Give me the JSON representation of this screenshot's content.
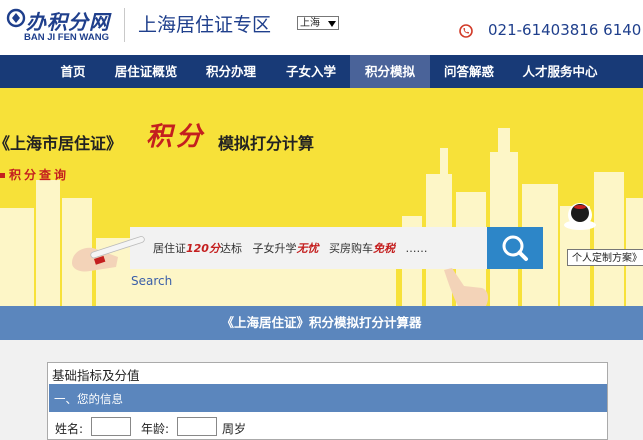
{
  "header": {
    "logo_cn": "办积分网",
    "logo_en": "BAN JI FEN WANG",
    "site_title": "上海居住证专区",
    "city_select": "上海",
    "phone": "021-61403816  6140"
  },
  "nav": {
    "items": [
      "首页",
      "居住证概览",
      "积分办理",
      "子女入学",
      "积分模拟",
      "问答解惑",
      "人才服务中心"
    ],
    "active": "积分模拟"
  },
  "banner": {
    "title": "《上海市居住证》",
    "title_red": "积分",
    "subtitle": "模拟打分计算",
    "query_label": "积分查询",
    "search": {
      "t1": "居住证",
      "t1_em": "120分",
      "t1_tail": "达标",
      "t2": "子女升学",
      "t2_em": "无忧",
      "t3": "买房购车",
      "t3_em": "免税",
      "dots": "……"
    },
    "search_caption": "Search",
    "custom_plan": "个人定制方案》"
  },
  "calculator": {
    "title": "《上海居住证》积分模拟打分计算器",
    "panel_head": "基础指标及分值",
    "section_title": "一、您的信息",
    "name_label": "姓名:",
    "age_label": "年龄:",
    "age_unit": "周岁"
  },
  "colors": {
    "nav_bg": "#183a77",
    "nav_active": "#4a6399",
    "banner_yellow": "#f7e139",
    "accent_red": "#c41f1f",
    "section_blue": "#5b86bd",
    "brand_blue": "#1f3f8c"
  }
}
